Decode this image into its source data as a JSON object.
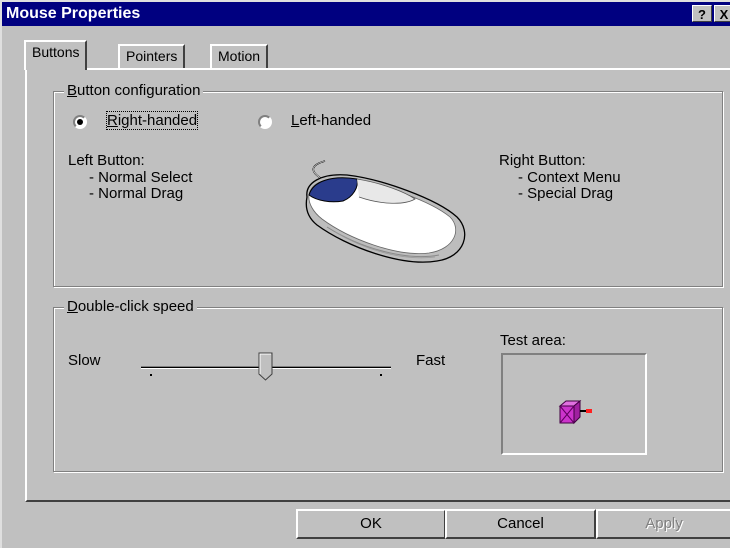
{
  "window": {
    "title": "Mouse Properties",
    "help_label": "?",
    "close_label": "X"
  },
  "tabs": [
    {
      "label": "Buttons",
      "active": true
    },
    {
      "label": "Pointers",
      "active": false
    },
    {
      "label": "Motion",
      "active": false
    }
  ],
  "button_config": {
    "legend_mnemonic": "B",
    "legend_rest": "utton configuration",
    "right_handed": {
      "mnemonic": "R",
      "rest": "ight-handed",
      "selected": true
    },
    "left_handed": {
      "mnemonic": "L",
      "rest": "eft-handed",
      "selected": false
    },
    "left_button": {
      "title": "Left Button:",
      "items": [
        "- Normal Select",
        "- Normal Drag"
      ]
    },
    "right_button": {
      "title": "Right Button:",
      "items": [
        "- Context Menu",
        "- Special Drag"
      ]
    },
    "mouse_icon": "mouse-icon"
  },
  "double_click": {
    "legend_mnemonic": "D",
    "legend_rest": "ouble-click speed",
    "slow_label": "Slow",
    "fast_label": "Fast",
    "slider_value": 0.5,
    "test_area_label": "Test area:",
    "test_icon": "jack-in-the-box-icon"
  },
  "buttons": {
    "ok": "OK",
    "cancel": "Cancel",
    "apply": "Apply",
    "apply_disabled": true
  },
  "colors": {
    "titlebar": "#000080",
    "face": "#c0c0c0",
    "mouse_button": "#2a3c8c",
    "test_box": "#cc33cc"
  }
}
